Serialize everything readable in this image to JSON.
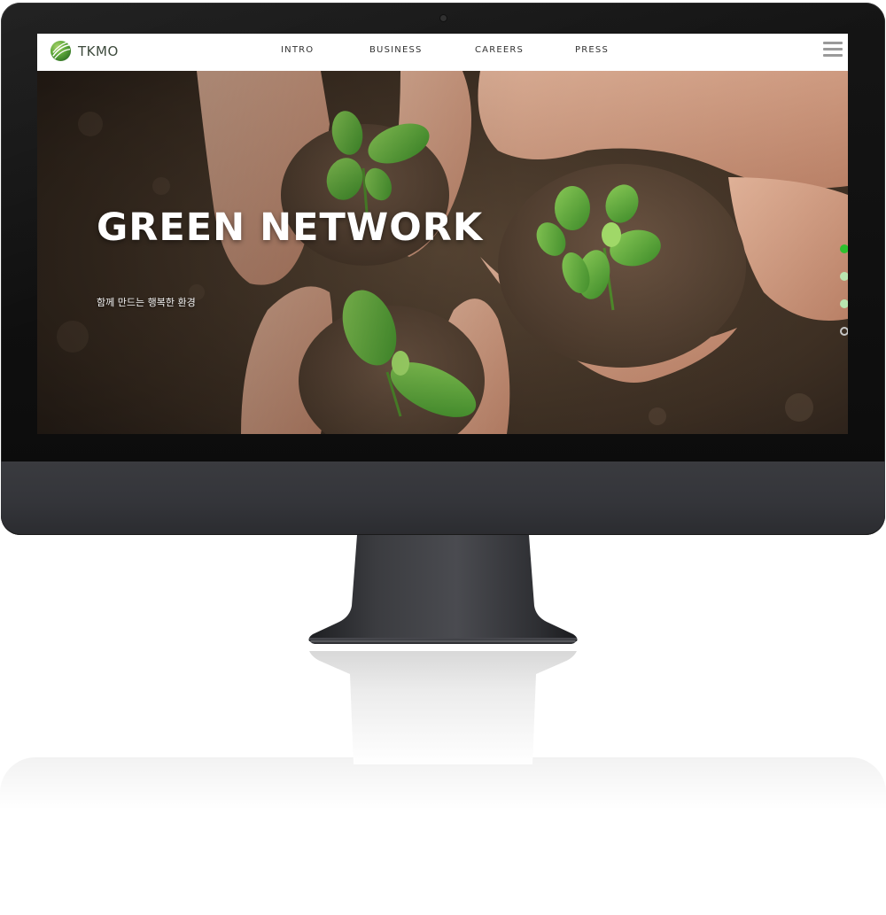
{
  "site": {
    "logo_text": "TKMO"
  },
  "nav": {
    "items": [
      {
        "label": "INTRO"
      },
      {
        "label": "BUSINESS"
      },
      {
        "label": "CAREERS"
      },
      {
        "label": "PRESS"
      }
    ],
    "menu_icon": "hamburger-icon"
  },
  "hero": {
    "title": "GREEN NETWORK",
    "subtitle": "함께 만드는 행복한 환경",
    "slides_total": 4,
    "active_slide": 1
  },
  "colors": {
    "accent_green": "#2ec12e",
    "inactive_dot": "#b9e6b0",
    "header_bg": "#ffffff",
    "monitor_bezel": "#0b0b0b",
    "monitor_chin": "#34353a"
  }
}
